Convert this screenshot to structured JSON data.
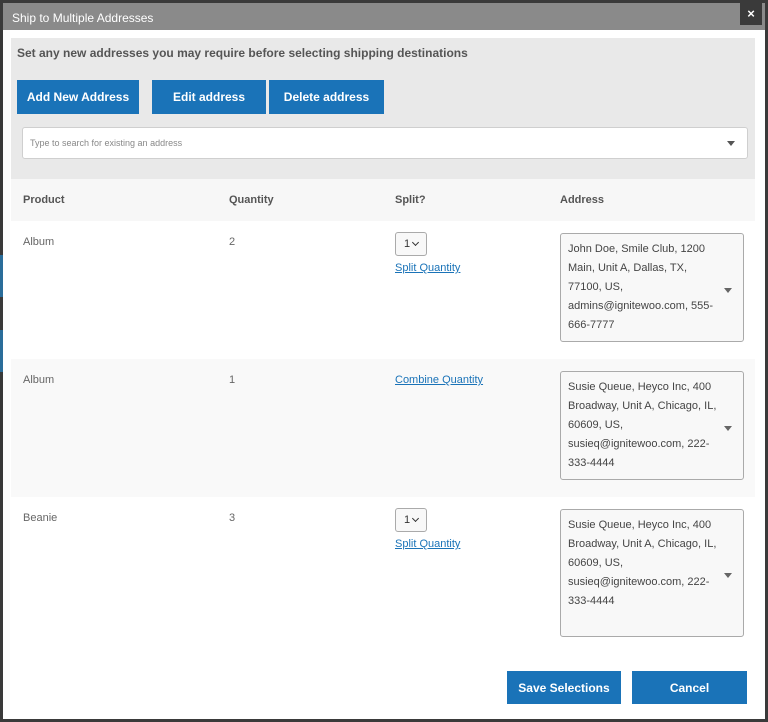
{
  "dialog": {
    "title": "Ship to Multiple Addresses",
    "close_label": "×"
  },
  "panel": {
    "heading": "Set any new addresses you may require before selecting shipping destinations",
    "add_label": "Add New Address",
    "edit_label": "Edit address",
    "delete_label": "Delete address",
    "search_placeholder": "Type to search for existing an address"
  },
  "table": {
    "headers": [
      "Product",
      "Quantity",
      "Split?",
      "Address"
    ],
    "rows": [
      {
        "product": "Album",
        "quantity": "2",
        "split_select": "1",
        "split_link": "Split Quantity",
        "address": "John Doe, Smile Club, 1200 Main, Unit A, Dallas, TX, 77100, US, admins@ignitewoo.com, 555-666-7777"
      },
      {
        "product": "Album",
        "quantity": "1",
        "split_link": "Combine Quantity",
        "address": "Susie Queue, Heyco Inc, 400 Broadway, Unit A, Chicago, IL, 60609, US, susieq@ignitewoo.com, 222-333-4444"
      },
      {
        "product": "Beanie",
        "quantity": "3",
        "split_select": "1",
        "split_link": "Split Quantity",
        "address": "Susie Queue, Heyco Inc, 400 Broadway, Unit A, Chicago, IL, 60609, US, susieq@ignitewoo.com, 222-333-4444"
      }
    ]
  },
  "footer": {
    "save_label": "Save Selections",
    "cancel_label": "Cancel"
  },
  "colors": {
    "accent": "#1a73b8",
    "titlebar": "#8a8a8a",
    "panel": "#e9e9e9"
  }
}
